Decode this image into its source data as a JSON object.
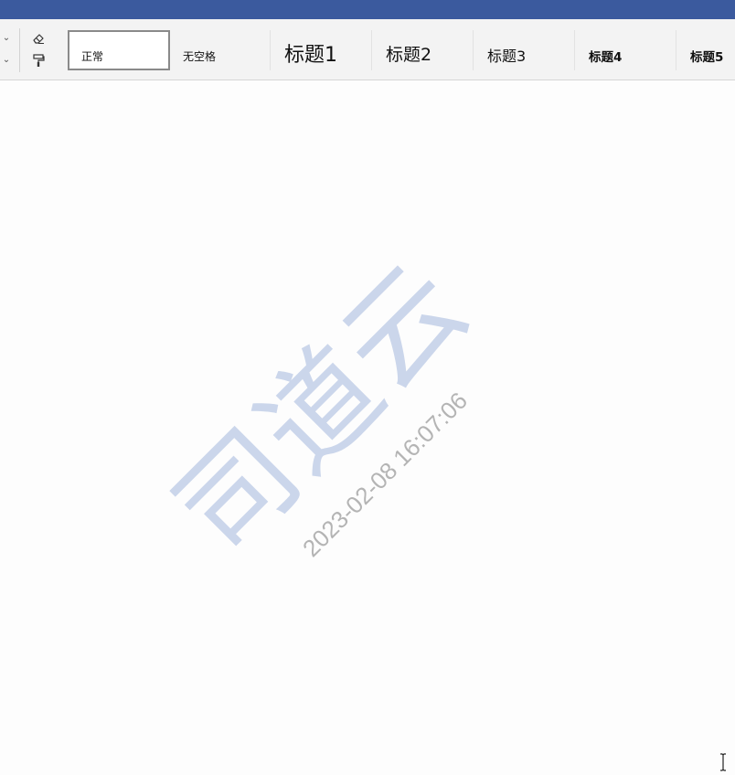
{
  "titlebar": {
    "color": "#3b5a9e"
  },
  "toolbar": {
    "icons": [
      "chevron-down-icon",
      "chevron-down-icon",
      "eraser-icon",
      "format-painter-icon"
    ]
  },
  "styles_gallery": {
    "items": [
      {
        "label": "正常",
        "selected": true
      },
      {
        "label": "无空格",
        "selected": false
      },
      {
        "label": "标题1",
        "selected": false
      },
      {
        "label": "标题2",
        "selected": false
      },
      {
        "label": "标题3",
        "selected": false
      },
      {
        "label": "标题4",
        "selected": false
      },
      {
        "label": "标题5",
        "selected": false
      }
    ]
  },
  "watermark": {
    "brand": "司道云",
    "timestamp": "2023-02-08 16:07:06",
    "brand_color": "#7896cd"
  },
  "cursor": {
    "icon": "text-cursor-icon"
  }
}
